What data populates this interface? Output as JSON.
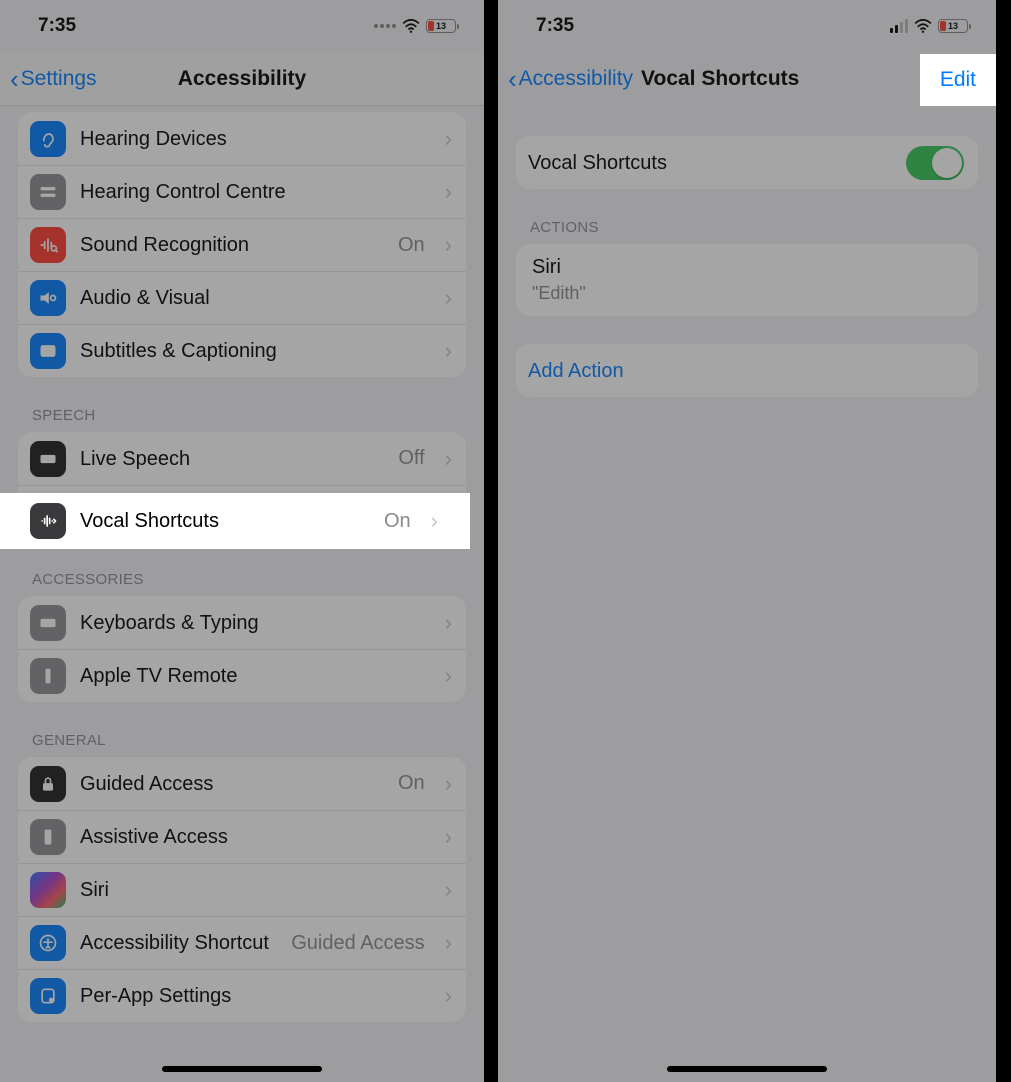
{
  "status": {
    "time": "7:35",
    "battery_pct": "13"
  },
  "left": {
    "back_label": "Settings",
    "title": "Accessibility",
    "hearing_group": [
      {
        "icon": "ear-icon",
        "label": "Hearing Devices"
      },
      {
        "icon": "slider-icon",
        "label": "Hearing Control Centre"
      },
      {
        "icon": "sound-rec-icon",
        "label": "Sound Recognition",
        "value": "On"
      },
      {
        "icon": "av-icon",
        "label": "Audio & Visual"
      },
      {
        "icon": "captions-icon",
        "label": "Subtitles & Captioning"
      }
    ],
    "speech_header": "SPEECH",
    "speech_group": [
      {
        "icon": "keyboard-icon",
        "label": "Live Speech",
        "value": "Off"
      },
      {
        "icon": "wave-icon",
        "label": "Vocal Shortcuts",
        "value": "On"
      }
    ],
    "accessories_header": "ACCESSORIES",
    "accessories_group": [
      {
        "icon": "keyboard-icon",
        "label": "Keyboards & Typing"
      },
      {
        "icon": "remote-icon",
        "label": "Apple TV Remote"
      }
    ],
    "general_header": "GENERAL",
    "general_group": [
      {
        "icon": "lock-icon",
        "label": "Guided Access",
        "value": "On"
      },
      {
        "icon": "phone-icon",
        "label": "Assistive Access"
      },
      {
        "icon": "siri-icon",
        "label": "Siri"
      },
      {
        "icon": "a11y-icon",
        "label": "Accessibility Shortcut",
        "value": "Guided Access"
      },
      {
        "icon": "perapp-icon",
        "label": "Per-App Settings"
      }
    ]
  },
  "right": {
    "back_label": "Accessibility",
    "title": "Vocal Shortcuts",
    "edit_label": "Edit",
    "toggle_label": "Vocal Shortcuts",
    "toggle_on": true,
    "actions_header": "ACTIONS",
    "action_name": "Siri",
    "action_phrase": "\"Edith\"",
    "add_label": "Add Action"
  }
}
